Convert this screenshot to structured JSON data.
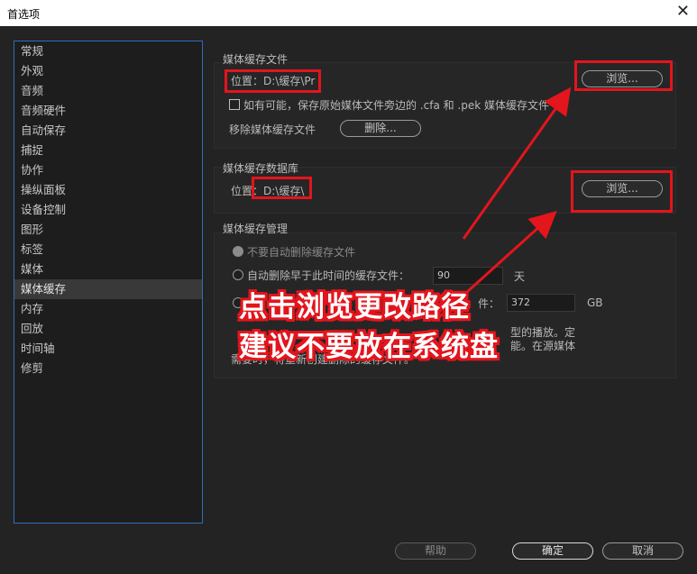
{
  "window": {
    "title": "首选项",
    "close_glyph": "✕"
  },
  "sidebar": {
    "items": [
      {
        "label": "常规"
      },
      {
        "label": "外观"
      },
      {
        "label": "音频"
      },
      {
        "label": "音频硬件"
      },
      {
        "label": "自动保存"
      },
      {
        "label": "捕捉"
      },
      {
        "label": "协作"
      },
      {
        "label": "操纵面板"
      },
      {
        "label": "设备控制"
      },
      {
        "label": "图形"
      },
      {
        "label": "标签"
      },
      {
        "label": "媒体"
      },
      {
        "label": "媒体缓存"
      },
      {
        "label": "内存"
      },
      {
        "label": "回放"
      },
      {
        "label": "时间轴"
      },
      {
        "label": "修剪"
      }
    ],
    "selected": "媒体缓存"
  },
  "media_cache_files": {
    "title": "媒体缓存文件",
    "location": "位置：D:\\缓存\\Pr",
    "browse_label": "浏览...",
    "checkbox_label": "如有可能，保存原始媒体文件旁边的 .cfa 和 .pek 媒体缓存文件",
    "remove_label": "移除媒体缓存文件",
    "delete_label": "删除..."
  },
  "media_cache_db": {
    "title": "媒体缓存数据库",
    "location": "位置：D:\\缓存\\",
    "browse_label": "浏览..."
  },
  "media_cache_mgmt": {
    "title": "媒体缓存管理",
    "option1": "不要自动删除缓存文件",
    "option2": "自动删除早于此时间的缓存文件：",
    "days_value": "90",
    "days_unit": "天",
    "option3_suffix": "件：",
    "size_value": "372",
    "size_unit": "GB",
    "info_line1_end": "型的播放。定",
    "info_line2_end": "能。在源媒体",
    "info_line3": "需要时，将重新创建删除的缓存文件。"
  },
  "annotation": {
    "line1": "点击浏览更改路径",
    "line2": "建议不要放在系统盘"
  },
  "footer": {
    "help_label": "帮助",
    "ok_label": "确定",
    "cancel_label": "取消"
  },
  "colors": {
    "highlight": "#e3151d",
    "accent_border": "#2d6fb8"
  }
}
